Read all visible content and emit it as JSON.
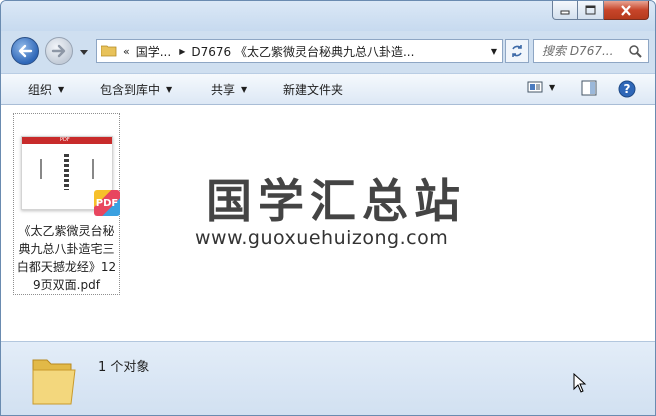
{
  "window": {
    "controls": {
      "minimize": "minimize",
      "maximize": "maximize",
      "close": "close"
    }
  },
  "nav": {
    "back_icon": "back-arrow-icon",
    "forward_icon": "forward-arrow-icon"
  },
  "address": {
    "overflow": "«",
    "segments": [
      "国学...",
      "D7676 《太乙紫微灵台秘典九总八卦造..."
    ]
  },
  "search": {
    "placeholder": "搜索 D767..."
  },
  "toolbar": {
    "organize": "组织",
    "include_library": "包含到库中",
    "share": "共享",
    "new_folder": "新建文件夹"
  },
  "file": {
    "name": "《太乙紫微灵台秘典九总八卦造宅三白都天撼龙经》129页双面.pdf",
    "thumb_header": "PDF",
    "badge": "PDF"
  },
  "watermark": {
    "title": "国学汇总站",
    "url": "www.guoxuehuizong.com"
  },
  "status": {
    "text": "1 个对象"
  },
  "colors": {
    "accent": "#2f67b8",
    "close": "#c7452a",
    "pdf_red": "#c82b2b"
  }
}
